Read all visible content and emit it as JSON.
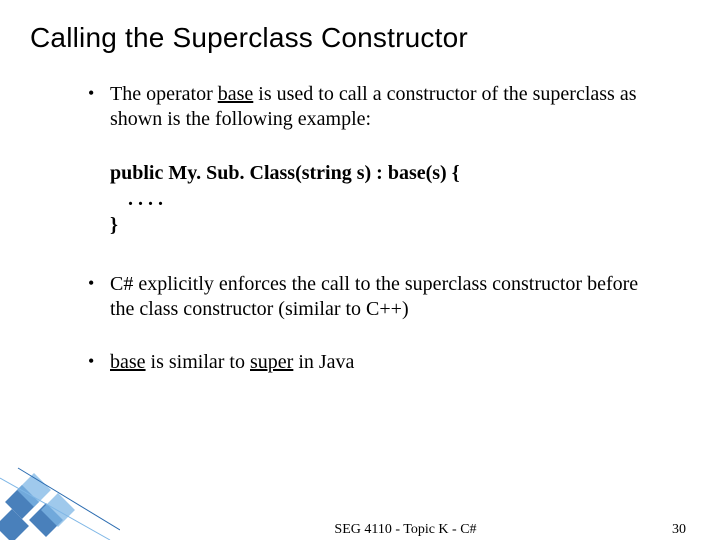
{
  "title": "Calling the Superclass Constructor",
  "bullets": {
    "b1_pre": "The operator ",
    "b1_u": "base",
    "b1_post": " is used to call a constructor of the superclass as shown is the following example:",
    "code1": "public My. Sub. Class(string s) : base(s) {",
    "code2": ". . . .",
    "code3": "}",
    "b2": "C# explicitly enforces the call to the superclass constructor before the class constructor (similar to C++)",
    "b3_pre": "",
    "b3_u1": "base",
    "b3_mid": " is similar to ",
    "b3_u2": "super",
    "b3_post": " in Java"
  },
  "footer": {
    "center": "SEG 4110 - Topic K - C#",
    "page": "30"
  }
}
